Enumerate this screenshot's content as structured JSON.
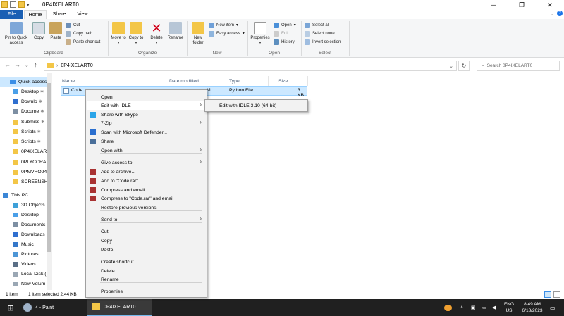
{
  "window": {
    "title": "0P4IXELART0"
  },
  "ribbon_tabs": [
    "File",
    "Home",
    "Share",
    "View"
  ],
  "ribbon": {
    "clipboard": {
      "pin": "Pin to Quick access",
      "copy": "Copy",
      "paste": "Paste",
      "cut": "Cut",
      "copy_path": "Copy path",
      "paste_shortcut": "Paste shortcut",
      "group": "Clipboard"
    },
    "organize": {
      "move_to": "Move to",
      "copy_to": "Copy to",
      "delete": "Delete",
      "rename": "Rename",
      "group": "Organize"
    },
    "new": {
      "new_folder": "New folder",
      "new_item": "New item",
      "easy_access": "Easy access",
      "group": "New"
    },
    "open": {
      "properties": "Properties",
      "open": "Open",
      "edit": "Edit",
      "history": "History",
      "group": "Open"
    },
    "select": {
      "select_all": "Select all",
      "select_none": "Select none",
      "invert": "Invert selection",
      "group": "Select"
    }
  },
  "address": {
    "path": "0P4IXELART0",
    "search_placeholder": "Search 0P4IXELART0"
  },
  "sidebar": {
    "items": [
      {
        "label": "Quick access",
        "color": "#3a8ee6"
      },
      {
        "label": "Desktop",
        "color": "#4a9fe8",
        "pin": "✱"
      },
      {
        "label": "Downlo",
        "color": "#2f6fcf",
        "pin": "✱"
      },
      {
        "label": "Docume",
        "color": "#7d8fa3",
        "pin": "✱"
      },
      {
        "label": "Submiss",
        "color": "#f3c647",
        "pin": "✱"
      },
      {
        "label": "Scripts",
        "color": "#f3c647",
        "pin": "✱"
      },
      {
        "label": "Scripts",
        "color": "#f3c647",
        "pin": "✱"
      },
      {
        "label": "0P4IXELART",
        "color": "#f3c647"
      },
      {
        "label": "0PLYCCRA",
        "color": "#f3c647"
      },
      {
        "label": "0PMVRO94",
        "color": "#f3c647"
      },
      {
        "label": "SCREENSH",
        "color": "#f3c647"
      },
      {
        "label": "This PC",
        "color": "#3b86d6"
      },
      {
        "label": "3D Objects",
        "color": "#3ea0d8"
      },
      {
        "label": "Desktop",
        "color": "#4a9fe8"
      },
      {
        "label": "Documents",
        "color": "#7d8fa3"
      },
      {
        "label": "Downloads",
        "color": "#2f6fcf"
      },
      {
        "label": "Music",
        "color": "#3577c9"
      },
      {
        "label": "Pictures",
        "color": "#4d96d6"
      },
      {
        "label": "Videos",
        "color": "#5a6f86"
      },
      {
        "label": "Local Disk (",
        "color": "#9aa7b4"
      },
      {
        "label": "New Volum",
        "color": "#9aa7b4"
      }
    ]
  },
  "columns": {
    "name": "Name",
    "date": "Date modified",
    "type": "Type",
    "size": "Size"
  },
  "file": {
    "name": "Code",
    "date_fragment": "M",
    "type": "Python File",
    "size": "3 KB"
  },
  "context_menu": {
    "items": [
      "Open",
      "Edit with IDLE",
      "Share with Skype",
      "7-Zip",
      "Scan with Microsoft Defender...",
      "Share",
      "Open with",
      "Give access to",
      "Add to archive...",
      "Add to \"Code.rar\"",
      "Compress and email...",
      "Compress to \"Code.rar\" and email",
      "Restore previous versions",
      "Send to",
      "Cut",
      "Copy",
      "Paste",
      "Create shortcut",
      "Delete",
      "Rename",
      "Properties"
    ]
  },
  "submenu": {
    "item": "Edit with IDLE 3.10 (64-bit)"
  },
  "status": {
    "count": "1 item",
    "selected": "1 item selected  2.44 KB"
  },
  "taskbar": {
    "paint": "4 - Paint",
    "explorer": "0P4IXELART0",
    "lang": "ENG",
    "region": "US",
    "time": "8:49 AM",
    "date": "6/18/2023"
  },
  "accent": "#1a5fb4"
}
